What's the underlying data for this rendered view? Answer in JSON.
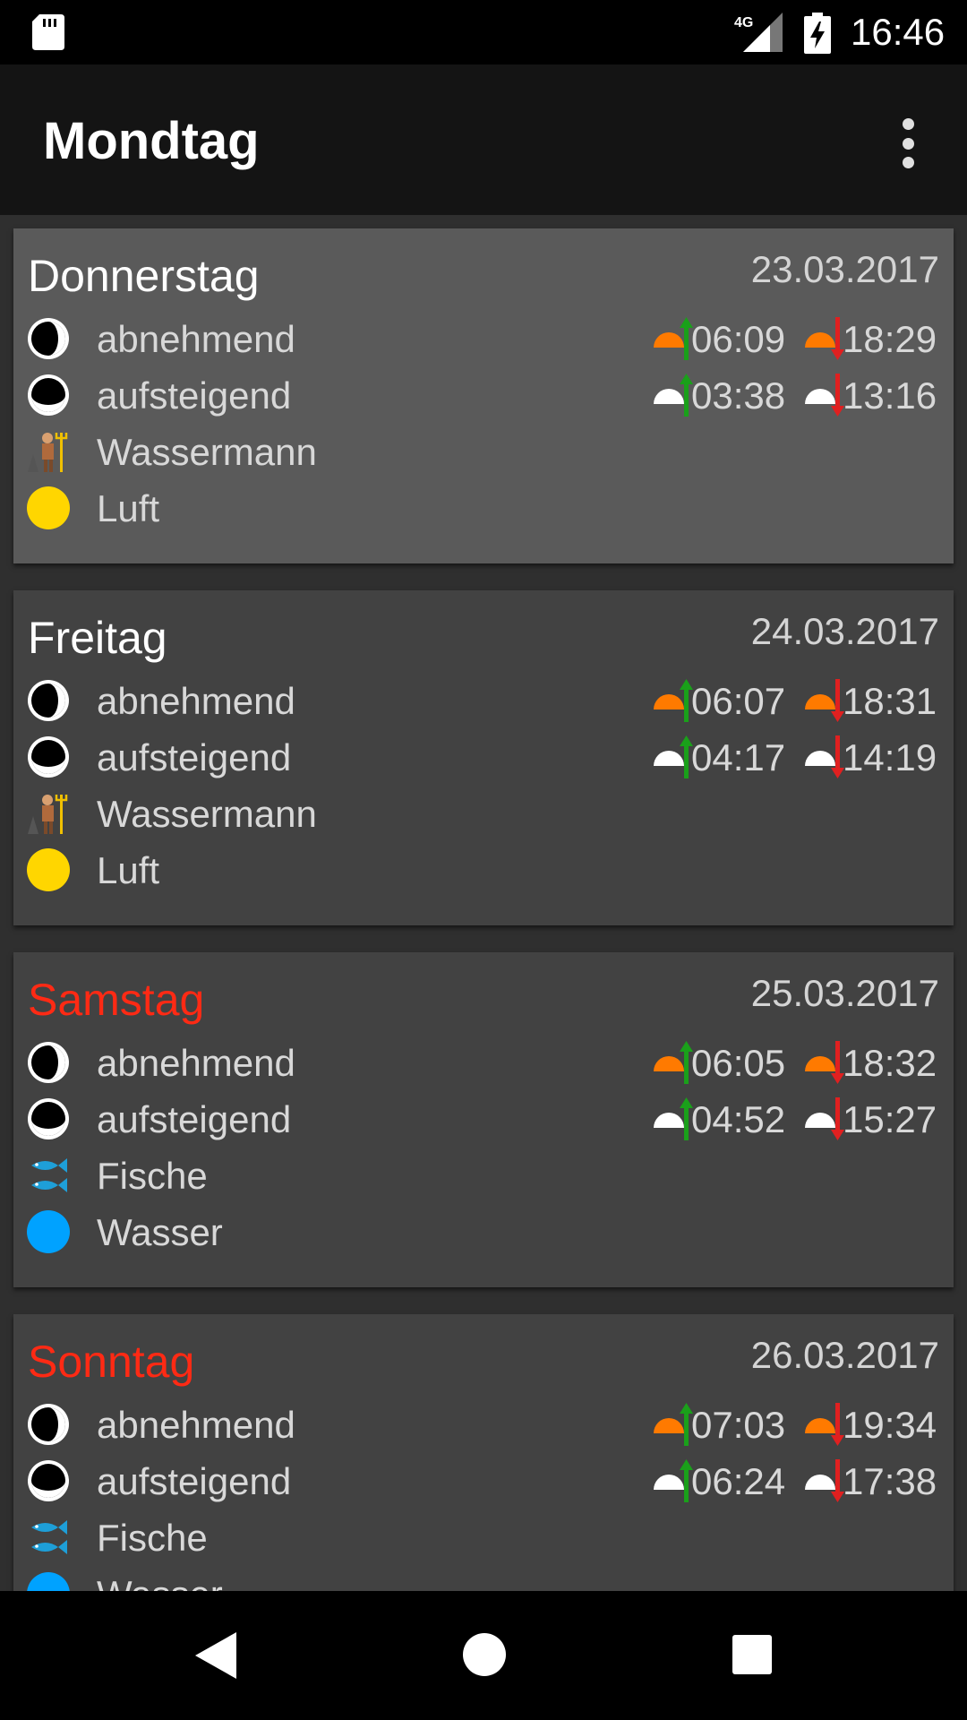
{
  "status_bar": {
    "network": "4G",
    "time": "16:46",
    "icons": [
      "sd-card-icon",
      "signal-icon",
      "battery-charging-icon"
    ]
  },
  "app_bar": {
    "title": "Mondtag",
    "menu_icon": "overflow-menu-icon"
  },
  "colors": {
    "weekend_red": "#ff2a14",
    "sun_orange": "#ff7a00",
    "rise_green": "#1aa01a",
    "set_red": "#e02020",
    "air_yellow": "#ffd600",
    "water_blue": "#00a2ff"
  },
  "days": [
    {
      "day": "Donnerstag",
      "date": "23.03.2017",
      "weekend": false,
      "phase": "abnehmend",
      "direction": "aufsteigend",
      "sign": "Wassermann",
      "sign_icon": "aquarius-icon",
      "element": "Luft",
      "element_icon": "air-element-icon",
      "sunrise": "06:09",
      "sunset": "18:29",
      "moonrise": "03:38",
      "moonset": "13:16"
    },
    {
      "day": "Freitag",
      "date": "24.03.2017",
      "weekend": false,
      "phase": "abnehmend",
      "direction": "aufsteigend",
      "sign": "Wassermann",
      "sign_icon": "aquarius-icon",
      "element": "Luft",
      "element_icon": "air-element-icon",
      "sunrise": "06:07",
      "sunset": "18:31",
      "moonrise": "04:17",
      "moonset": "14:19"
    },
    {
      "day": "Samstag",
      "date": "25.03.2017",
      "weekend": true,
      "phase": "abnehmend",
      "direction": "aufsteigend",
      "sign": "Fische",
      "sign_icon": "pisces-icon",
      "element": "Wasser",
      "element_icon": "water-element-icon",
      "sunrise": "06:05",
      "sunset": "18:32",
      "moonrise": "04:52",
      "moonset": "15:27"
    },
    {
      "day": "Sonntag",
      "date": "26.03.2017",
      "weekend": true,
      "phase": "abnehmend",
      "direction": "aufsteigend",
      "sign": "Fische",
      "sign_icon": "pisces-icon",
      "element": "Wasser",
      "element_icon": "water-element-icon",
      "sunrise": "07:03",
      "sunset": "19:34",
      "moonrise": "06:24",
      "moonset": "17:38"
    }
  ],
  "nav_bar": {
    "buttons": [
      "back-icon",
      "home-icon",
      "recents-icon"
    ]
  }
}
